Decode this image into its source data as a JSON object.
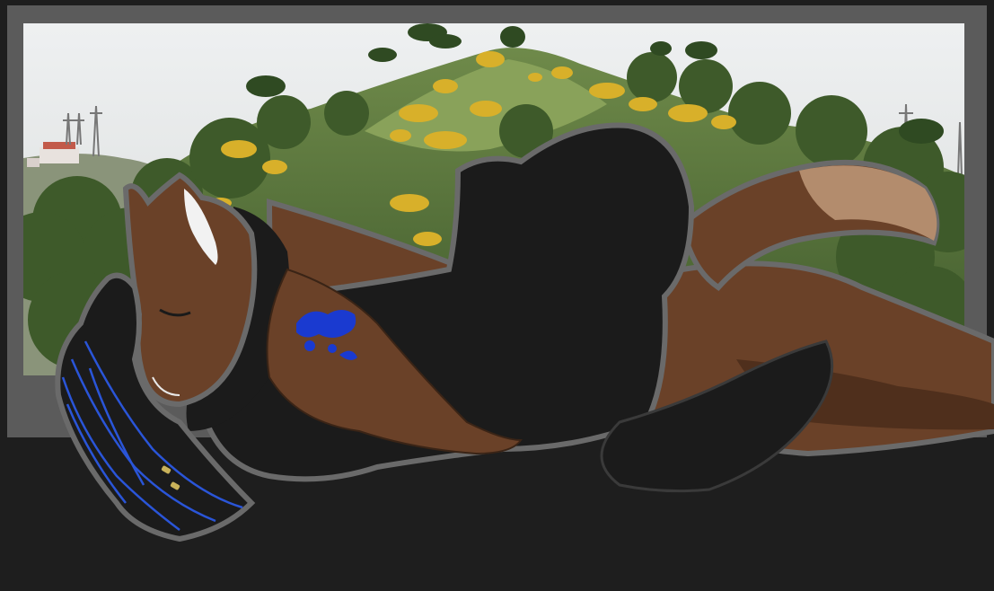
{
  "image": {
    "kind": "digital illustration composited over a landscape photograph",
    "colors": {
      "background": "#1e1e1e",
      "frame": "#5b5b5b",
      "sky": "#e4e7e9",
      "hill_green": "#5f7a3e",
      "broom_yellow": "#d8b02a",
      "brown_fur": "#6a4128",
      "brown_shade": "#4f2f1c",
      "tan_fur": "#b38c6d",
      "black_fur": "#1b1b1b",
      "outline": "#6a6a6a",
      "hair_blue": "#2a55d8",
      "marking_blue": "#1a3ad0",
      "bead_gold": "#c9b25a"
    }
  }
}
